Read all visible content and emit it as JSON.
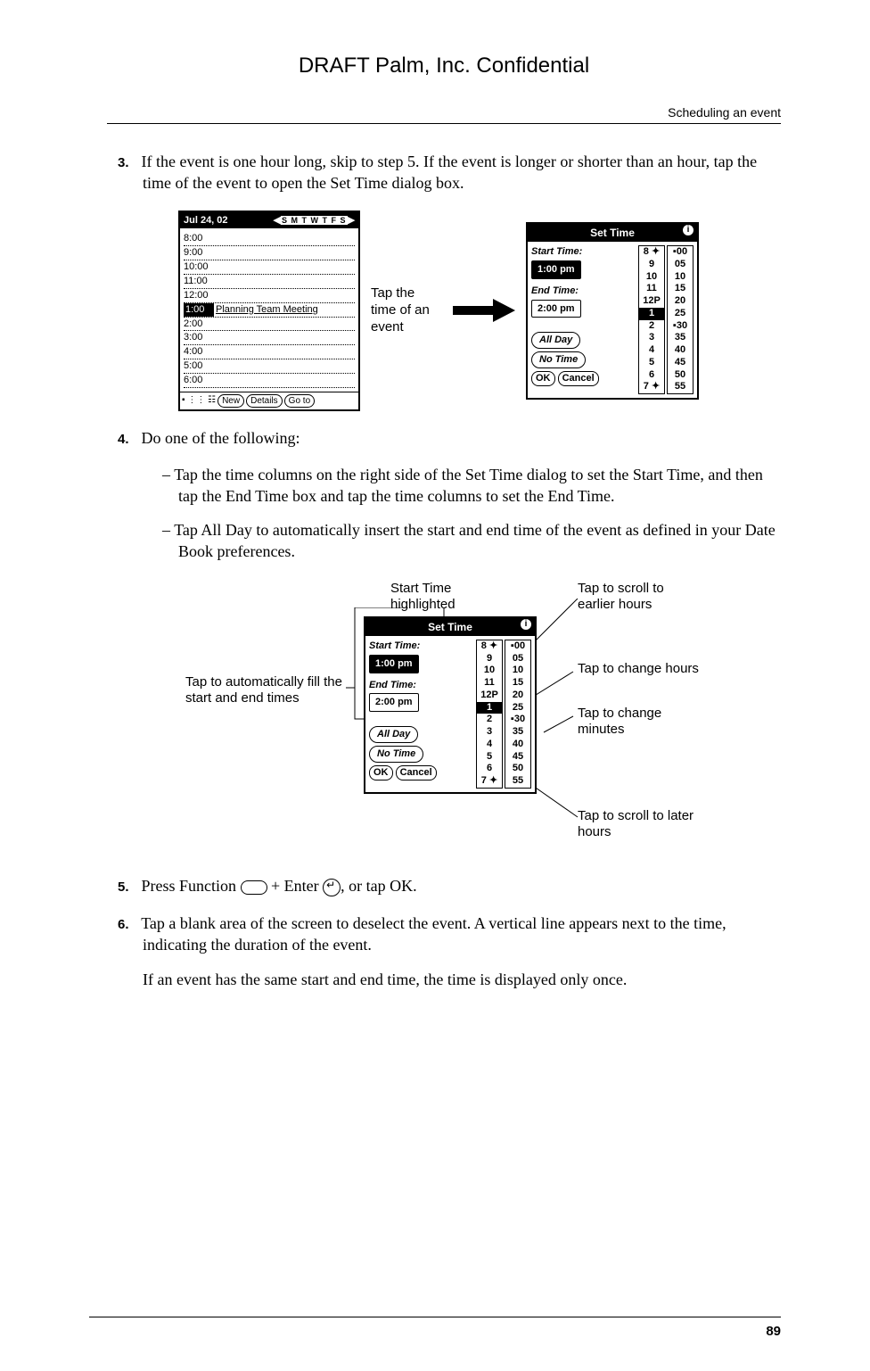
{
  "header": {
    "draft_text": "DRAFT   Palm, Inc. Confidential",
    "section_title": "Scheduling an event"
  },
  "steps": {
    "s3": {
      "num": "3.",
      "text": "If the event is one hour long, skip to step 5. If the event is longer or shorter than an hour, tap the time of the event to open the Set Time dialog box."
    },
    "s4": {
      "num": "4.",
      "text": "Do one of the following:"
    },
    "s4a": "Tap the time columns on the right side of the Set Time dialog to set the Start Time, and then tap the End Time box and tap the time columns to set the End Time.",
    "s4b": "Tap All Day to automatically insert the start and end time of the event as defined in your Date Book preferences.",
    "s5": {
      "num": "5.",
      "pre": "Press Function ",
      "mid": " + Enter ",
      "post": ", or tap OK."
    },
    "s6": {
      "num": "6.",
      "text": "Tap a blank area of the screen to deselect the event. A vertical line appears next to the time, indicating the duration of the event."
    },
    "s6b": "If an event has the same start and end time, the time is displayed only once."
  },
  "fig1": {
    "date": "Jul 24, 02",
    "days": "S M T W T F S",
    "hours": [
      "8:00",
      "9:00",
      "10:00",
      "11:00",
      "12:00"
    ],
    "sel_time": "1:00",
    "sel_label": "Planning Team Meeting",
    "hours2": [
      "2:00",
      "3:00",
      "4:00",
      "5:00",
      "6:00"
    ],
    "foot": {
      "new": "New",
      "details": "Details",
      "goto": "Go to"
    },
    "caption": "Tap the time of an event"
  },
  "settime": {
    "title": "Set Time",
    "start_label": "Start Time:",
    "start_value": "1:00 pm",
    "end_label": "End Time:",
    "end_value": "2:00 pm",
    "allday": "All Day",
    "notime": "No Time",
    "ok": "OK",
    "cancel": "Cancel",
    "hours": [
      "8 ✦",
      "9",
      "10",
      "11",
      "12P",
      "1",
      "2",
      "3",
      "4",
      "5",
      "6",
      "7 ✦"
    ],
    "hour_selected_index": 5,
    "minutes": [
      "▪00",
      "05",
      "10",
      "15",
      "20",
      "25",
      "▪30",
      "35",
      "40",
      "45",
      "50",
      "55"
    ]
  },
  "fig2_labels": {
    "start_hl": "Start Time highlighted",
    "scroll_up": "Tap to scroll to earlier hours",
    "auto_fill": "Tap to automatically fill the start and end times",
    "chg_hours": "Tap to change hours",
    "chg_min": "Tap to change minutes",
    "scroll_down": "Tap to scroll to later hours"
  },
  "footer": {
    "page": "89"
  }
}
